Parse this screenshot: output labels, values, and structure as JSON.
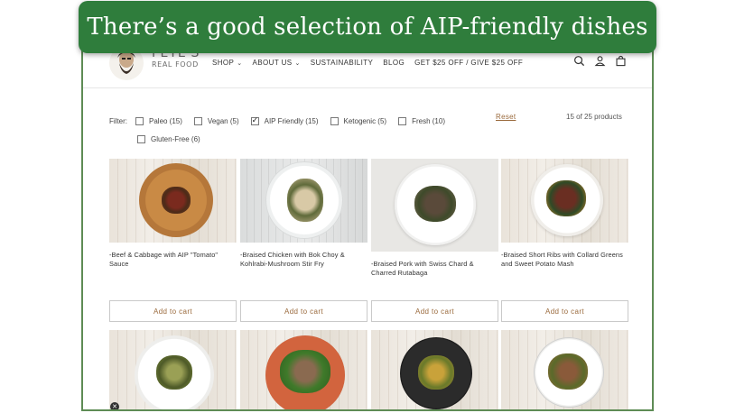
{
  "banner": {
    "text": "There’s a good selection of AIP-friendly dishes"
  },
  "header": {
    "brand_line1": "PETE'S",
    "brand_line2": "REAL FOOD",
    "nav": [
      {
        "label": "SHOP",
        "dropdown": true
      },
      {
        "label": "ABOUT US",
        "dropdown": true
      },
      {
        "label": "SUSTAINABILITY",
        "dropdown": false
      },
      {
        "label": "BLOG",
        "dropdown": false
      },
      {
        "label": "GET $25 OFF / GIVE $25 OFF",
        "dropdown": false
      }
    ],
    "icons": [
      "search-icon",
      "account-icon",
      "cart-icon"
    ]
  },
  "filters": {
    "label": "Filter:",
    "options": [
      {
        "label": "Paleo (15)",
        "checked": false
      },
      {
        "label": "Vegan (5)",
        "checked": false
      },
      {
        "label": "AIP Friendly (15)",
        "checked": true
      },
      {
        "label": "Ketogenic (5)",
        "checked": false
      },
      {
        "label": "Fresh (10)",
        "checked": false
      },
      {
        "label": "Gluten-Free (6)",
        "checked": false
      }
    ],
    "reset": "Reset",
    "count": "15 of 25 products"
  },
  "products": [
    {
      "name": "-Beef & Cabbage with AIP \"Tomato\" Sauce",
      "button": "Add to cart"
    },
    {
      "name": "-Braised Chicken with Bok Choy & Kohlrabi-Mushroom Stir Fry",
      "button": "Add to cart"
    },
    {
      "name": "-Braised Pork with Swiss Chard & Charred Rutabaga",
      "button": "Add to cart"
    },
    {
      "name": "-Braised Short Ribs with Collard Greens and Sweet Potato Mash",
      "button": "Add to cart"
    }
  ],
  "colors": {
    "banner": "#2f7d3c",
    "accent": "#9a6a3c",
    "frame": "#5e8c55"
  }
}
